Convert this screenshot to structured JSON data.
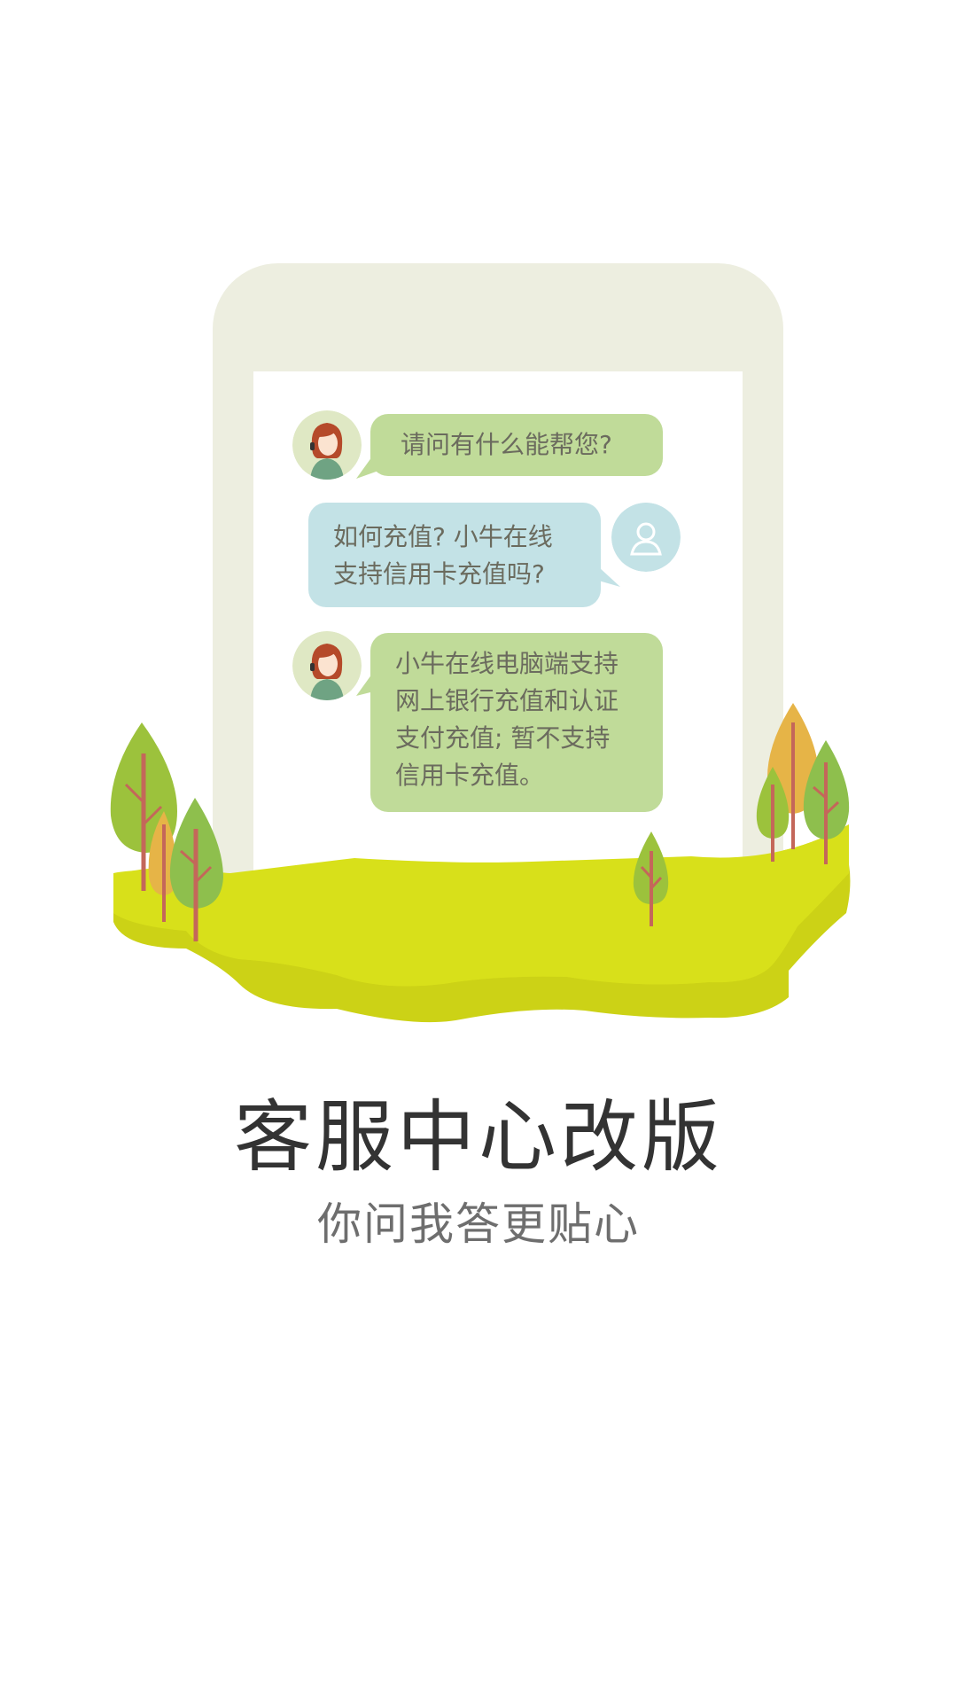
{
  "chat": {
    "agent_greeting": "请问有什么能帮您?",
    "user_question_line1": "如何充值? 小牛在线",
    "user_question_line2": "支持信用卡充值吗?",
    "agent_reply_line1": "小牛在线电脑端支持",
    "agent_reply_line2": "网上银行充值和认证",
    "agent_reply_line3": "支付充值; 暂不支持",
    "agent_reply_line4": "信用卡充值。"
  },
  "headline": "客服中心改版",
  "subline": "你问我答更贴心",
  "colors": {
    "frame": "#edeee0",
    "agent_bubble": "#c0db99",
    "user_bubble": "#c3e2e6",
    "grass_top": "#d6de1a",
    "grass_side": "#c8d019"
  }
}
